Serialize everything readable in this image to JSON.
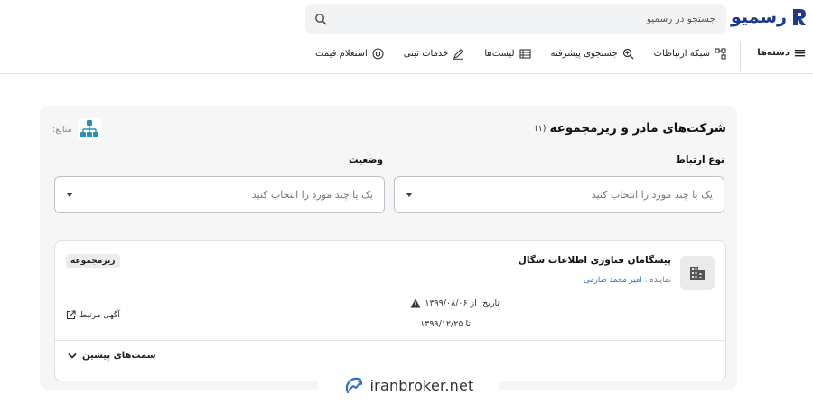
{
  "brand": {
    "name": "رسمیو",
    "color": "#1d3a8a"
  },
  "search": {
    "placeholder": "جستجو در رسمیو",
    "icon": "search-icon"
  },
  "nav": {
    "categories_label": "دسته‌ها",
    "items": [
      {
        "label": "شبکه ارتباطات",
        "icon": "network-icon"
      },
      {
        "label": "جستجوی پیشرفته",
        "icon": "search-plus-icon"
      },
      {
        "label": "لیست‌ها",
        "icon": "list-icon"
      },
      {
        "label": "خدمات ثبتی",
        "icon": "pen-icon"
      },
      {
        "label": "استعلام قیمت",
        "icon": "price-icon"
      }
    ]
  },
  "panel": {
    "title": "شرکت‌های مادر و زیرمجموعه",
    "count": "(۱)",
    "sources_label": "منابع:",
    "filters": {
      "relation_label": "نوع ارتباط",
      "relation_placeholder": "یک یا چند مورد را انتخاب کنید",
      "status_label": "وضعیت",
      "status_placeholder": "یک یا چند مورد را انتخاب کنید"
    },
    "card": {
      "company_name": "پیشگامان فناوری اطلاعات سگال",
      "rep_label": "نماینده :",
      "rep_name": "امیر محمد صارمی",
      "badge": "زیرمجموعه",
      "date_from": "تاریخ: از ۱۳۹۹/۰۸/۰۶",
      "date_to": "تا ۱۳۹۹/۱۲/۲۵",
      "ad_link": "آگهی مرتبط",
      "history_label": "سمت‌های پیشین"
    }
  },
  "watermark": {
    "text": "iranbroker.net"
  },
  "colors": {
    "accent": "#2a6fd6",
    "panel_bg": "#f6f6f7"
  }
}
